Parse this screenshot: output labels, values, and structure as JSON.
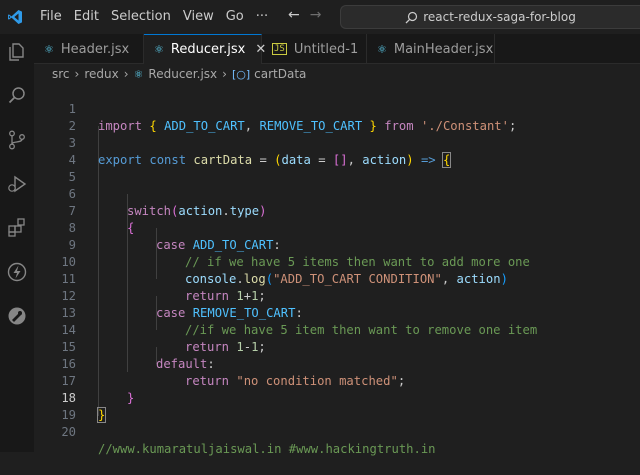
{
  "menu": [
    "File",
    "Edit",
    "Selection",
    "View",
    "Go",
    "···"
  ],
  "search": {
    "text": "react-redux-saga-for-blog"
  },
  "tabs": [
    {
      "label": "Header.jsx",
      "active": false
    },
    {
      "label": "Reducer.jsx",
      "active": true
    },
    {
      "label": "Untitled-1",
      "active": false
    },
    {
      "label": "MainHeader.jsx",
      "active": false
    }
  ],
  "breadcrumb": [
    "src",
    "redux",
    "Reducer.jsx",
    "cartData"
  ],
  "editor": {
    "current_line": 18,
    "line_numbers": [
      "1",
      "2",
      "3",
      "4",
      "5",
      "6",
      "7",
      "8",
      "9",
      "10",
      "11",
      "12",
      "13",
      "14",
      "15",
      "16",
      "17",
      "18",
      "19",
      "20"
    ],
    "tokens": {
      "l1": [
        "import",
        "{",
        "ADD_TO_CART",
        ",",
        "REMOVE_TO_CART",
        "}",
        "from",
        "'./Constant'",
        ";"
      ],
      "l3": [
        "export",
        "const",
        "cartData",
        "=",
        "(",
        "data",
        "=",
        "[]",
        ",",
        "action",
        ")",
        "=>",
        "{"
      ],
      "l6": [
        "switch",
        "(",
        "action",
        ".",
        "type",
        ")"
      ],
      "l7": [
        "{"
      ],
      "l8": [
        "case",
        "ADD_TO_CART",
        ":"
      ],
      "l9": [
        "// if we have 5 items then want to add more one"
      ],
      "l10": [
        "console",
        ".",
        "log",
        "(",
        "\"ADD_TO_CART CONDITION\"",
        ",",
        "action",
        ")"
      ],
      "l11": [
        "return",
        "1",
        "+",
        "1",
        ";"
      ],
      "l12": [
        "case",
        "REMOVE_TO_CART",
        ":"
      ],
      "l13": [
        "//if we have 5 item then want to remove one item"
      ],
      "l14": [
        "return",
        "1",
        "-",
        "1",
        ";"
      ],
      "l15": [
        "default",
        ":"
      ],
      "l16": [
        "return",
        "\"no condition matched\"",
        ";"
      ],
      "l17": [
        "}"
      ],
      "l18": [
        "}"
      ],
      "l20": [
        "//www.kumaratuljaiswal.in #www.hackingtruth.in"
      ]
    }
  },
  "colors": {
    "accent": "#0078d4",
    "keyword": "#569cd6",
    "control": "#c586c0",
    "variable": "#9cdcfe",
    "constant": "#4fc1ff",
    "function": "#dcdcaa",
    "string": "#ce9178",
    "number": "#b5cea8",
    "comment": "#6a9955"
  },
  "icons": [
    "vscode-logo-icon",
    "arrow-left-icon",
    "arrow-right-icon",
    "search-icon",
    "explorer-icon",
    "search-view-icon",
    "source-control-icon",
    "run-debug-icon",
    "extensions-icon",
    "thunder-client-icon",
    "remote-icon",
    "react-file-icon",
    "js-file-icon",
    "close-icon",
    "symbol-variable-icon"
  ]
}
